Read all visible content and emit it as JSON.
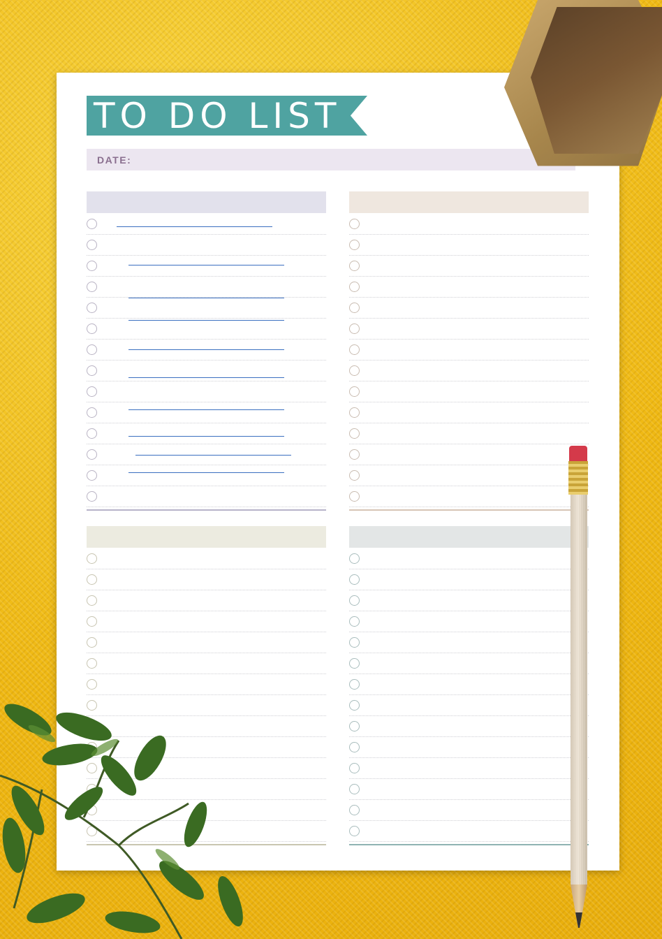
{
  "planner": {
    "title": "TO DO LIST",
    "date_label": "DATE:"
  },
  "colors": {
    "banner": "#4fa3a1",
    "date_bar": "#ece6f0",
    "background": "#f3c21c",
    "pen_ink": "#3a6fc0"
  },
  "sections": [
    {
      "id": "top-left",
      "header_color": "#e2e1ec",
      "line_color": "#b7b3c9",
      "rows": 14,
      "circle_color": "#b8b2c3"
    },
    {
      "id": "top-right",
      "header_color": "#efe7df",
      "line_color": "#d6c5b5",
      "rows": 14,
      "circle_color": "#c9bcb1"
    },
    {
      "id": "bottom-left",
      "header_color": "#ecebe0",
      "line_color": "#c9c6b0",
      "rows": 14,
      "circle_color": "#c7c4b0"
    },
    {
      "id": "bottom-right",
      "header_color": "#e3e6e6",
      "line_color": "#8fb3b2",
      "rows": 14,
      "circle_color": "#a9bdbd"
    }
  ],
  "icons": {
    "checkbox": "circle-checkbox-icon",
    "pencil": "pencil-icon",
    "pot": "hexagon-planter",
    "plant": "plant-leaves"
  }
}
